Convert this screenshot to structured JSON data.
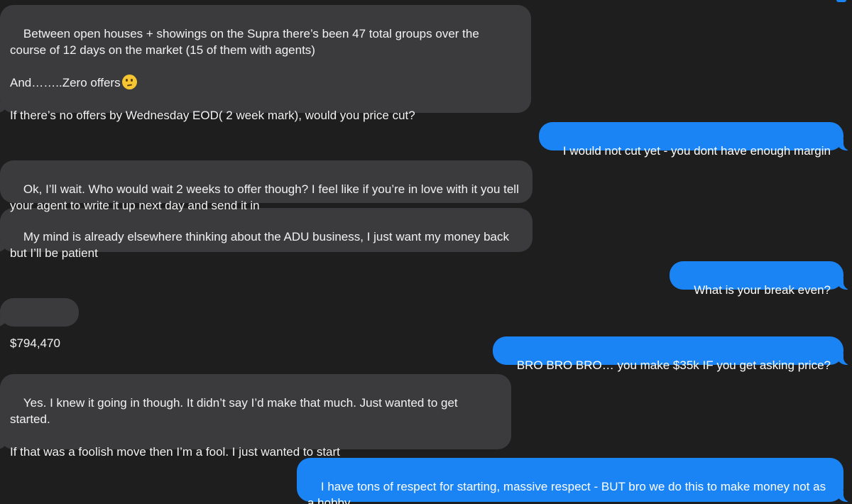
{
  "messages": [
    {
      "direction": "incoming",
      "text": "Between open houses + showings on the Supra there’s been 47 total groups over the course of 12 days on the market (15 of them with agents)\n\nAnd……..Zero offers",
      "emoji": "thinking-face",
      "text_after_emoji": "\n\nIf there’s no offers by Wednesday EOD( 2 week mark), would you price cut?"
    },
    {
      "direction": "outgoing",
      "text": "I would not cut yet - you dont have enough margin"
    },
    {
      "direction": "incoming",
      "text": "Ok, I’ll wait. Who would wait 2 weeks to offer though? I feel like if you’re in love with it you tell your agent to write it up next day and send it in"
    },
    {
      "direction": "incoming",
      "text": "My mind is already elsewhere thinking about the ADU business, I just want my money back but I’ll be patient"
    },
    {
      "direction": "outgoing",
      "text": "What is your break even?"
    },
    {
      "direction": "incoming",
      "text": "$794,470"
    },
    {
      "direction": "outgoing",
      "text": "BRO BRO BRO… you make $35k IF you get asking price?"
    },
    {
      "direction": "incoming",
      "text": "Yes. I knew it going in though. It didn’t say I’d make that much. Just wanted to get started.\n\nIf that was a foolish move then I’m a fool. I just wanted to start"
    },
    {
      "direction": "outgoing",
      "text": "I have tons of respect for starting, massive respect - BUT bro we do this to make money not as a hobby"
    }
  ],
  "colors": {
    "background": "#1e1e1e",
    "incoming_bubble": "#3b3b3d",
    "outgoing_bubble": "#1a84f5",
    "text": "#f2f2f2"
  }
}
